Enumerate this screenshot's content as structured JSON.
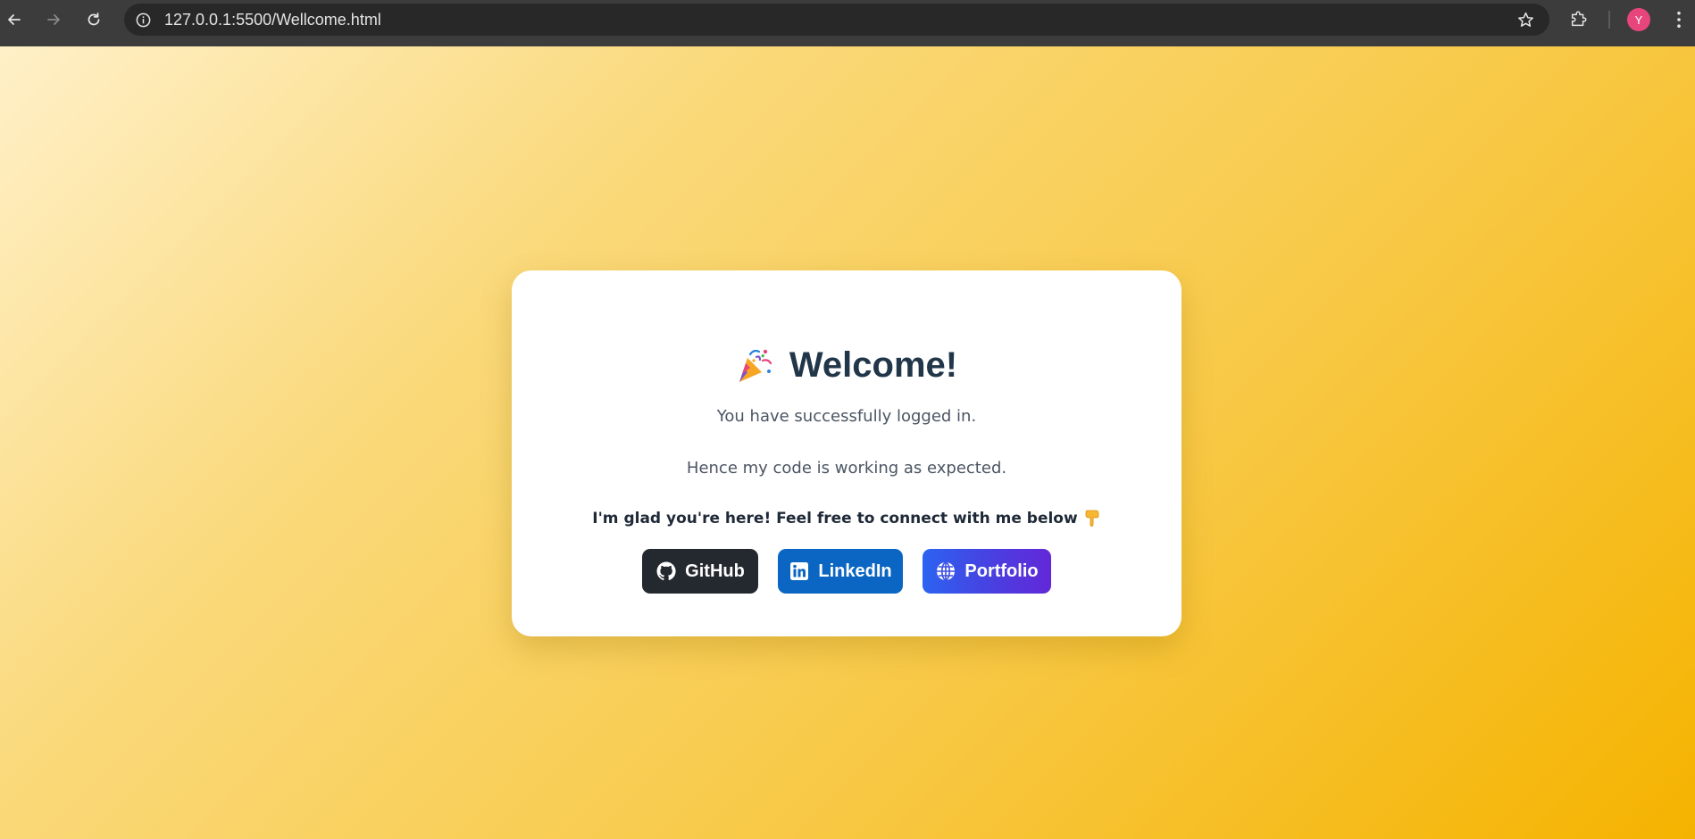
{
  "browser": {
    "url": "127.0.0.1:5500/Wellcome.html",
    "avatar_letter": "Y",
    "icons": {
      "back": "arrow-left-icon",
      "forward": "arrow-right-icon",
      "reload": "reload-icon",
      "site_info": "info-icon",
      "bookmark": "star-icon",
      "extensions": "puzzle-icon",
      "menu": "kebab-menu-icon"
    }
  },
  "page": {
    "background_colors": [
      "#fff0c8",
      "#f5b300"
    ]
  },
  "card": {
    "title": "Welcome!",
    "title_icon": "party-popper-icon",
    "message_1": "You have successfully logged in.",
    "message_2": "Hence my code is working as expected.",
    "invite": "I'm glad you're here! Feel free to connect with me below",
    "invite_icon": "pointing-down-hand-icon",
    "buttons": [
      {
        "label": "GitHub",
        "icon": "github-icon",
        "color": "#24292f"
      },
      {
        "label": "LinkedIn",
        "icon": "linkedin-icon",
        "color": "#0a66c2"
      },
      {
        "label": "Portfolio",
        "icon": "globe-icon",
        "color": "#2b63f0"
      }
    ]
  }
}
